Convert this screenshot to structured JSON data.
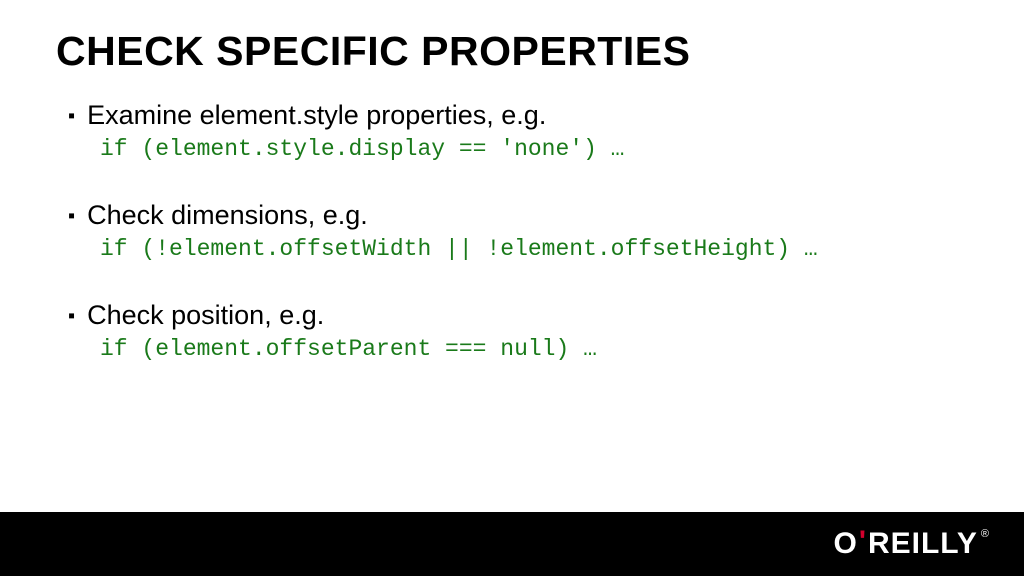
{
  "slide": {
    "title": "CHECK SPECIFIC PROPERTIES",
    "bullets": [
      {
        "text": "Examine element.style properties, e.g.",
        "code": "if (element.style.display == 'none') …"
      },
      {
        "text": "Check dimensions, e.g.",
        "code": "if (!element.offsetWidth || !element.offsetHeight) …"
      },
      {
        "text": "Check position, e.g.",
        "code": "if (element.offsetParent === null) …"
      }
    ]
  },
  "footer": {
    "logo": {
      "part1": "O",
      "apostrophe": "'",
      "part2": "REILLY",
      "reg": "®"
    }
  }
}
